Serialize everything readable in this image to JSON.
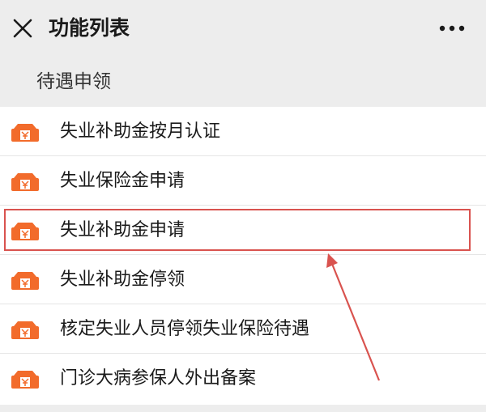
{
  "nav": {
    "close_icon": "close-icon",
    "title": "功能列表",
    "more_icon": "more-dots-icon"
  },
  "section": {
    "title": "待遇申领"
  },
  "items": [
    {
      "label": "失业补助金按月认证",
      "icon": "wallet-icon"
    },
    {
      "label": "失业保险金申请",
      "icon": "wallet-icon"
    },
    {
      "label": "失业补助金申请",
      "icon": "wallet-icon",
      "highlighted": true
    },
    {
      "label": "失业补助金停领",
      "icon": "wallet-icon"
    },
    {
      "label": "核定失业人员停领失业保险待遇",
      "icon": "wallet-icon"
    },
    {
      "label": "门诊大病参保人外出备案",
      "icon": "wallet-icon"
    }
  ],
  "colors": {
    "icon_orange": "#f26b2b",
    "highlight_red": "#d9534f",
    "background": "#ededed"
  }
}
